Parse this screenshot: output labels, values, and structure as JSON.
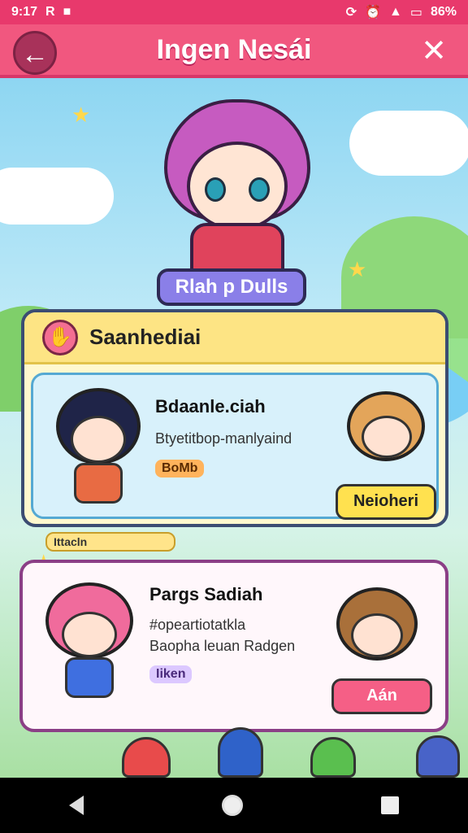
{
  "status_bar": {
    "time": "9:17",
    "left_icons": [
      "R",
      "■"
    ],
    "battery_text": "86%"
  },
  "app_bar": {
    "title": "Ingen Nesái",
    "back_icon": "arrow-left-icon",
    "close_icon": "close-icon"
  },
  "hero": {
    "name_plate": "Rlah p Dulls"
  },
  "card1": {
    "header_label": "Saanhediai",
    "name": "Bdaanle.ciah",
    "description": "Btyetitbop-manlyaind",
    "tag": "BoMb",
    "button": "Neioheri"
  },
  "strip": {
    "label": "Ittacln"
  },
  "card2": {
    "name": "Pargs Sadiah",
    "description_line1": "#opeartiotatkla",
    "description_line2": "Baopha leuan Radgen",
    "tag": "Iiken",
    "button": "Aán"
  },
  "colors": {
    "accent": "#f1577f",
    "header_bg": "#e8396c",
    "card1_border": "#3b4c72",
    "card2_border": "#8b3f86"
  }
}
